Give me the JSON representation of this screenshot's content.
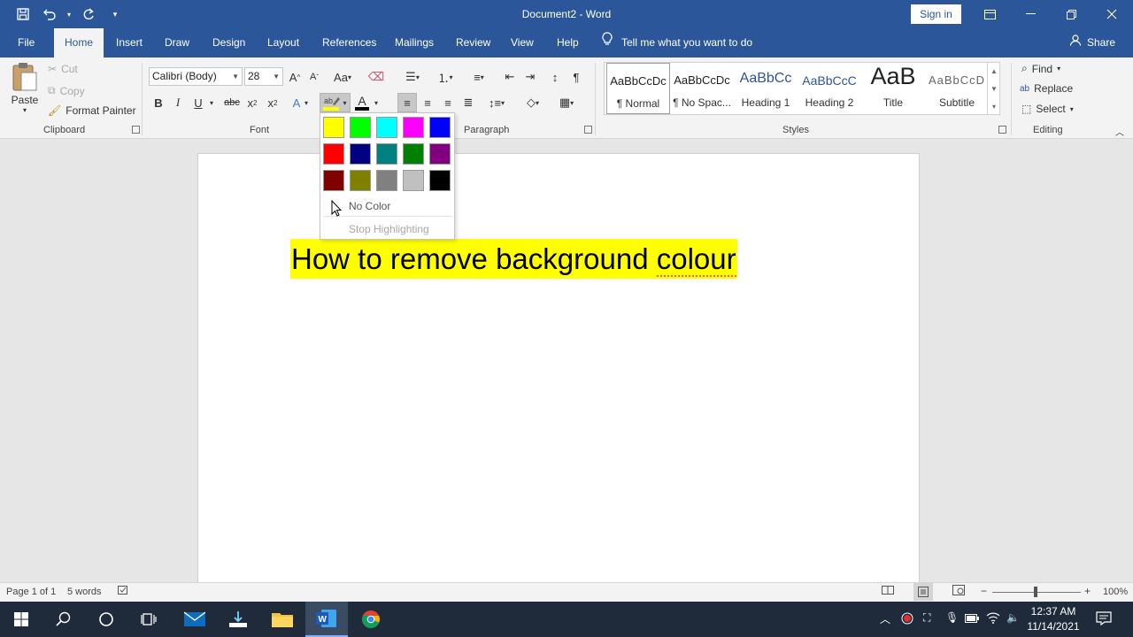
{
  "window": {
    "title": "Document2  -  Word",
    "sign_in": "Sign in"
  },
  "tabs": [
    "File",
    "Home",
    "Insert",
    "Draw",
    "Design",
    "Layout",
    "References",
    "Mailings",
    "Review",
    "View",
    "Help"
  ],
  "tell_me": "Tell me what you want to do",
  "share": "Share",
  "clipboard": {
    "paste": "Paste",
    "cut": "Cut",
    "copy": "Copy",
    "format_painter": "Format Painter",
    "label": "Clipboard"
  },
  "font": {
    "family": "Calibri (Body)",
    "size": "28",
    "label": "Font"
  },
  "paragraph": {
    "label": "Paragraph"
  },
  "styles": {
    "label": "Styles",
    "items": [
      {
        "preview": "AaBbCcDc",
        "name": "¶ Normal"
      },
      {
        "preview": "AaBbCcDc",
        "name": "¶ No Spac..."
      },
      {
        "preview": "AaBbCc",
        "name": "Heading 1"
      },
      {
        "preview": "AaBbCcC",
        "name": "Heading 2"
      },
      {
        "preview": "AaB",
        "name": "Title"
      },
      {
        "preview": "AaBbCcD",
        "name": "Subtitle"
      }
    ]
  },
  "editing": {
    "find": "Find",
    "replace": "Replace",
    "select": "Select",
    "label": "Editing"
  },
  "highlight_menu": {
    "colors": [
      "#ffff00",
      "#00ff00",
      "#00ffff",
      "#ff00ff",
      "#0000ff",
      "#ff0000",
      "#000080",
      "#008080",
      "#008000",
      "#800080",
      "#800000",
      "#808000",
      "#808080",
      "#c0c0c0",
      "#000000"
    ],
    "no_color": "No Color",
    "stop": "Stop Highlighting"
  },
  "document": {
    "text_main": "How to remove background ",
    "text_squiggle": "colour",
    "highlight": "#ffff00"
  },
  "status": {
    "page": "Page 1 of 1",
    "words": "5 words",
    "zoom": "100%"
  },
  "taskbar": {
    "time": "12:37 AM",
    "date": "11/14/2021"
  },
  "colors": {
    "accent": "#2b579a",
    "ribbon": "#f3f3f3"
  }
}
